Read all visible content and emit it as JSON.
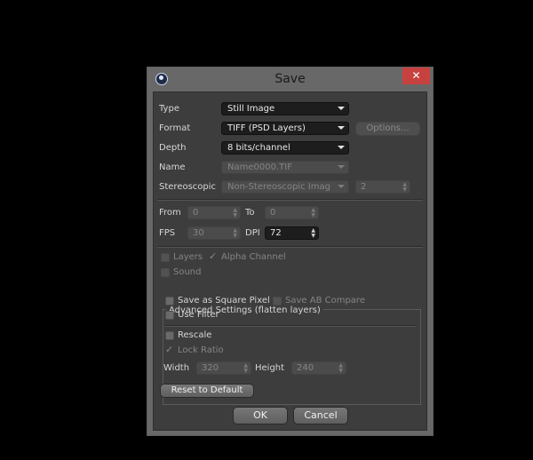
{
  "dialog": {
    "title": "Save",
    "close_label": "✕"
  },
  "type": {
    "label": "Type",
    "value": "Still Image"
  },
  "format": {
    "label": "Format",
    "value": "TIFF (PSD Layers)",
    "options_label": "Options..."
  },
  "depth": {
    "label": "Depth",
    "value": "8 bits/channel"
  },
  "name": {
    "label": "Name",
    "value": "Name0000.TIF"
  },
  "stereoscopic": {
    "label": "Stereoscopic",
    "value": "Non-Stereoscopic Imag",
    "count": "2"
  },
  "range": {
    "from_label": "From",
    "from_value": "0",
    "to_label": "To",
    "to_value": "0"
  },
  "fps": {
    "label": "FPS",
    "value": "30"
  },
  "dpi": {
    "label": "DPI",
    "value": "72"
  },
  "layers": {
    "label": "Layers"
  },
  "alpha": {
    "label": "Alpha Channel"
  },
  "sound": {
    "label": "Sound"
  },
  "advanced": {
    "title": "Advanced Settings (flatten layers)",
    "square_pixel": "Save as Square Pixel",
    "ab_compare": "Save AB Compare",
    "use_filter": "Use Filter",
    "rescale": "Rescale",
    "lock_ratio": "Lock Ratio",
    "width_label": "Width",
    "width_value": "320",
    "height_label": "Height",
    "height_value": "240"
  },
  "buttons": {
    "reset": "Reset to Default",
    "ok": "OK",
    "cancel": "Cancel"
  }
}
